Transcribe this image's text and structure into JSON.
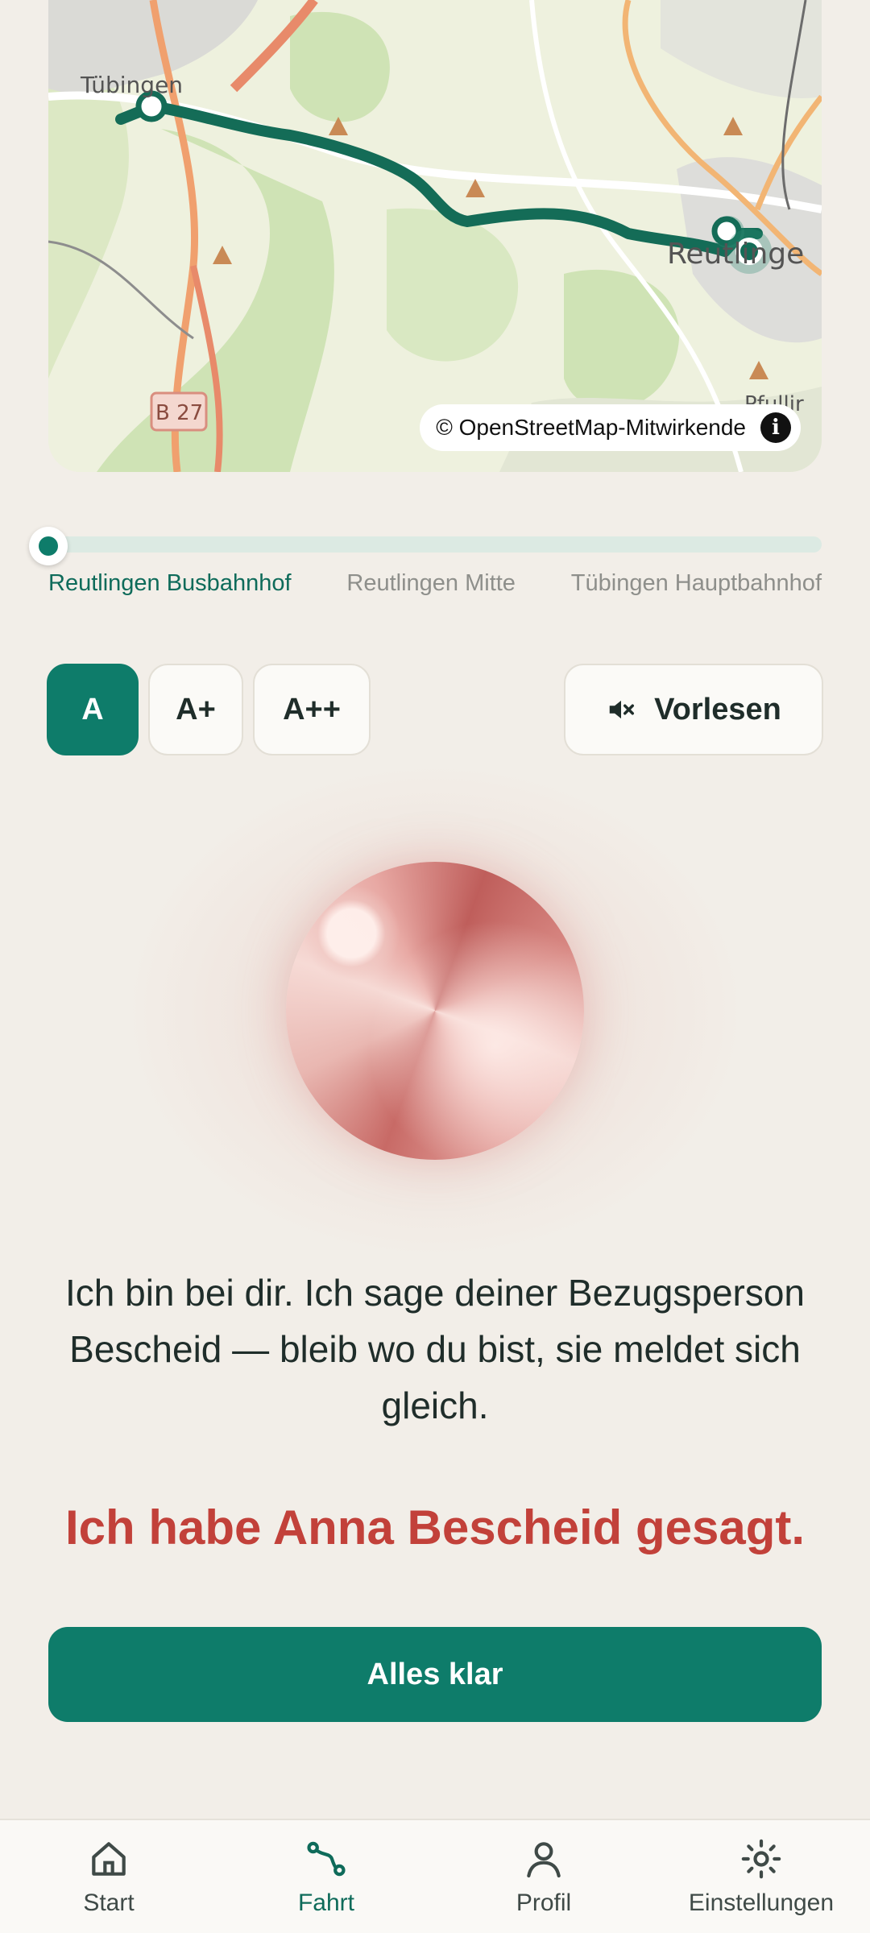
{
  "map": {
    "labels": [
      "Tübingen",
      "Reutlinge",
      "B 27",
      "Pfullir"
    ],
    "attribution": "© OpenStreetMap-Mitwirkende",
    "info_icon": "info-icon"
  },
  "route_progress": {
    "fraction": 0.0,
    "stops": [
      "Reutlingen Busbahnhof",
      "Reutlingen Mitte",
      "Tübingen Hauptbahnhof"
    ],
    "current_stop_index": 0
  },
  "font_size": {
    "options": [
      "A",
      "A+",
      "A++"
    ],
    "selected": "A"
  },
  "read_aloud": {
    "label": "Vorlesen",
    "icon": "speaker-muted-icon"
  },
  "message": "Ich bin bei dir. Ich sage deiner Bezugsperson Bescheid — bleib wo du bist, sie meldet sich gleich.",
  "alert": "Ich habe Anna Bescheid gesagt.",
  "primary_button": "Alles klar",
  "nav": [
    {
      "label": "Start",
      "icon": "home-icon"
    },
    {
      "label": "Fahrt",
      "icon": "route-icon",
      "active": true
    },
    {
      "label": "Profil",
      "icon": "user-icon"
    },
    {
      "label": "Einstellungen",
      "icon": "gear-icon"
    }
  ],
  "colors": {
    "accent": "#0E7C6A",
    "alert": "#C2413A",
    "background": "#F2EEE8"
  }
}
